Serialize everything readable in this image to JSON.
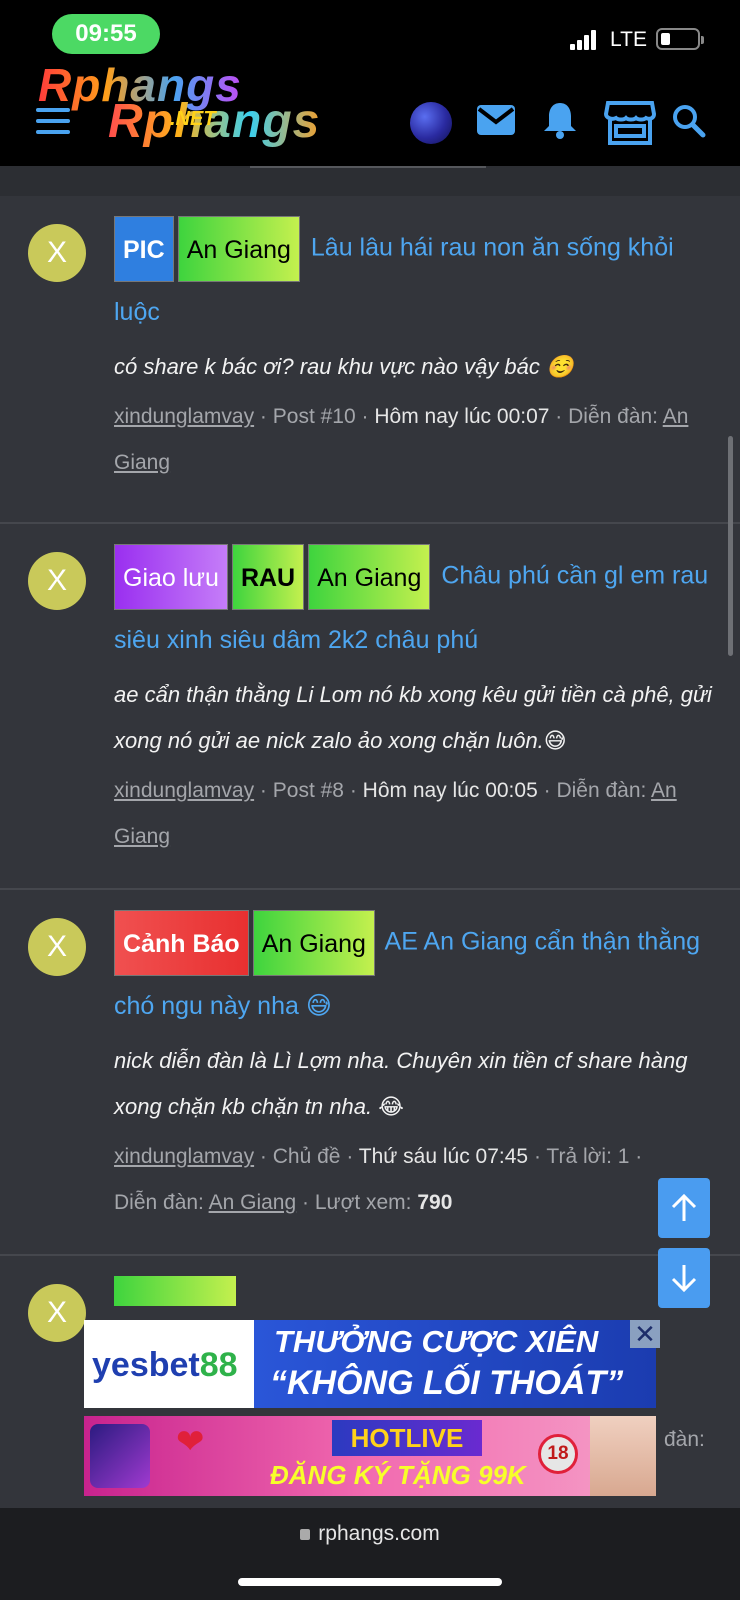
{
  "status_bar": {
    "time": "09:55",
    "network": "LTE"
  },
  "header": {
    "logo_text_top": "Rphangs",
    "logo_text_bottom": "Rphangs",
    "logo_net": ".NET",
    "icons": [
      "menu-icon",
      "avatar",
      "mail-icon",
      "bell-icon",
      "store-icon",
      "search-icon"
    ]
  },
  "posts": [
    {
      "avatar_letter": "X",
      "tags": [
        {
          "label": "PIC",
          "style": "blue"
        },
        {
          "label": "An Giang",
          "style": "green"
        }
      ],
      "title": "Lâu lâu hái rau non ăn sống khỏi luộc",
      "snippet": "có share k bác ơi? rau khu vực nào vậy bác ☺️",
      "author": "xindunglamvay",
      "post_ref": "Post #10",
      "time": "Hôm nay lúc 00:07",
      "forum_label": "Diễn đàn:",
      "forum": "An Giang"
    },
    {
      "avatar_letter": "X",
      "tags": [
        {
          "label": "Giao lưu",
          "style": "purple"
        },
        {
          "label": "RAU",
          "style": "green-bold"
        },
        {
          "label": "An Giang",
          "style": "green"
        }
      ],
      "title": "Châu phú cần gl em rau siêu xinh siêu dâm 2k2 châu phú",
      "snippet": "ae cẩn thận thằng Li Lom nó kb xong kêu gửi tiền cà phê, gửi xong nó gửi ae nick zalo ảo xong chặn luôn.😅",
      "author": "xindunglamvay",
      "post_ref": "Post #8",
      "time": "Hôm nay lúc 00:05",
      "forum_label": "Diễn đàn:",
      "forum": "An Giang"
    },
    {
      "avatar_letter": "X",
      "tags": [
        {
          "label": "Cảnh Báo",
          "style": "red"
        },
        {
          "label": "An Giang",
          "style": "green"
        }
      ],
      "title": "AE An Giang cẩn thận thằng chó ngu này nha 😅",
      "snippet": "nick diễn đàn là Lì Lợm nha. Chuyên xin tiền cf share hàng xong chặn kb chặn tn nha. 😂",
      "author": "xindunglamvay",
      "thread_label": "Chủ đề",
      "time": "Thứ sáu lúc 07:45",
      "replies": "Trả lời: 1",
      "forum_label": "Diễn đàn:",
      "forum": "An Giang",
      "views_label": "Lượt xem:",
      "views": "790"
    },
    {
      "avatar_letter": "X"
    }
  ],
  "ads": {
    "banner1": {
      "brand_a": "yesbet",
      "brand_b": "88",
      "line1": "THƯỞNG CƯỢC XIÊN",
      "line2": "“KHÔNG LỐI THOÁT”",
      "close": "✕"
    },
    "banner2": {
      "hotline": "HOTLIVE",
      "line": "ĐĂNG KÝ TẶNG 99K",
      "age": "18"
    },
    "side_text": "đàn:"
  },
  "browser": {
    "url": "rphangs.com"
  }
}
